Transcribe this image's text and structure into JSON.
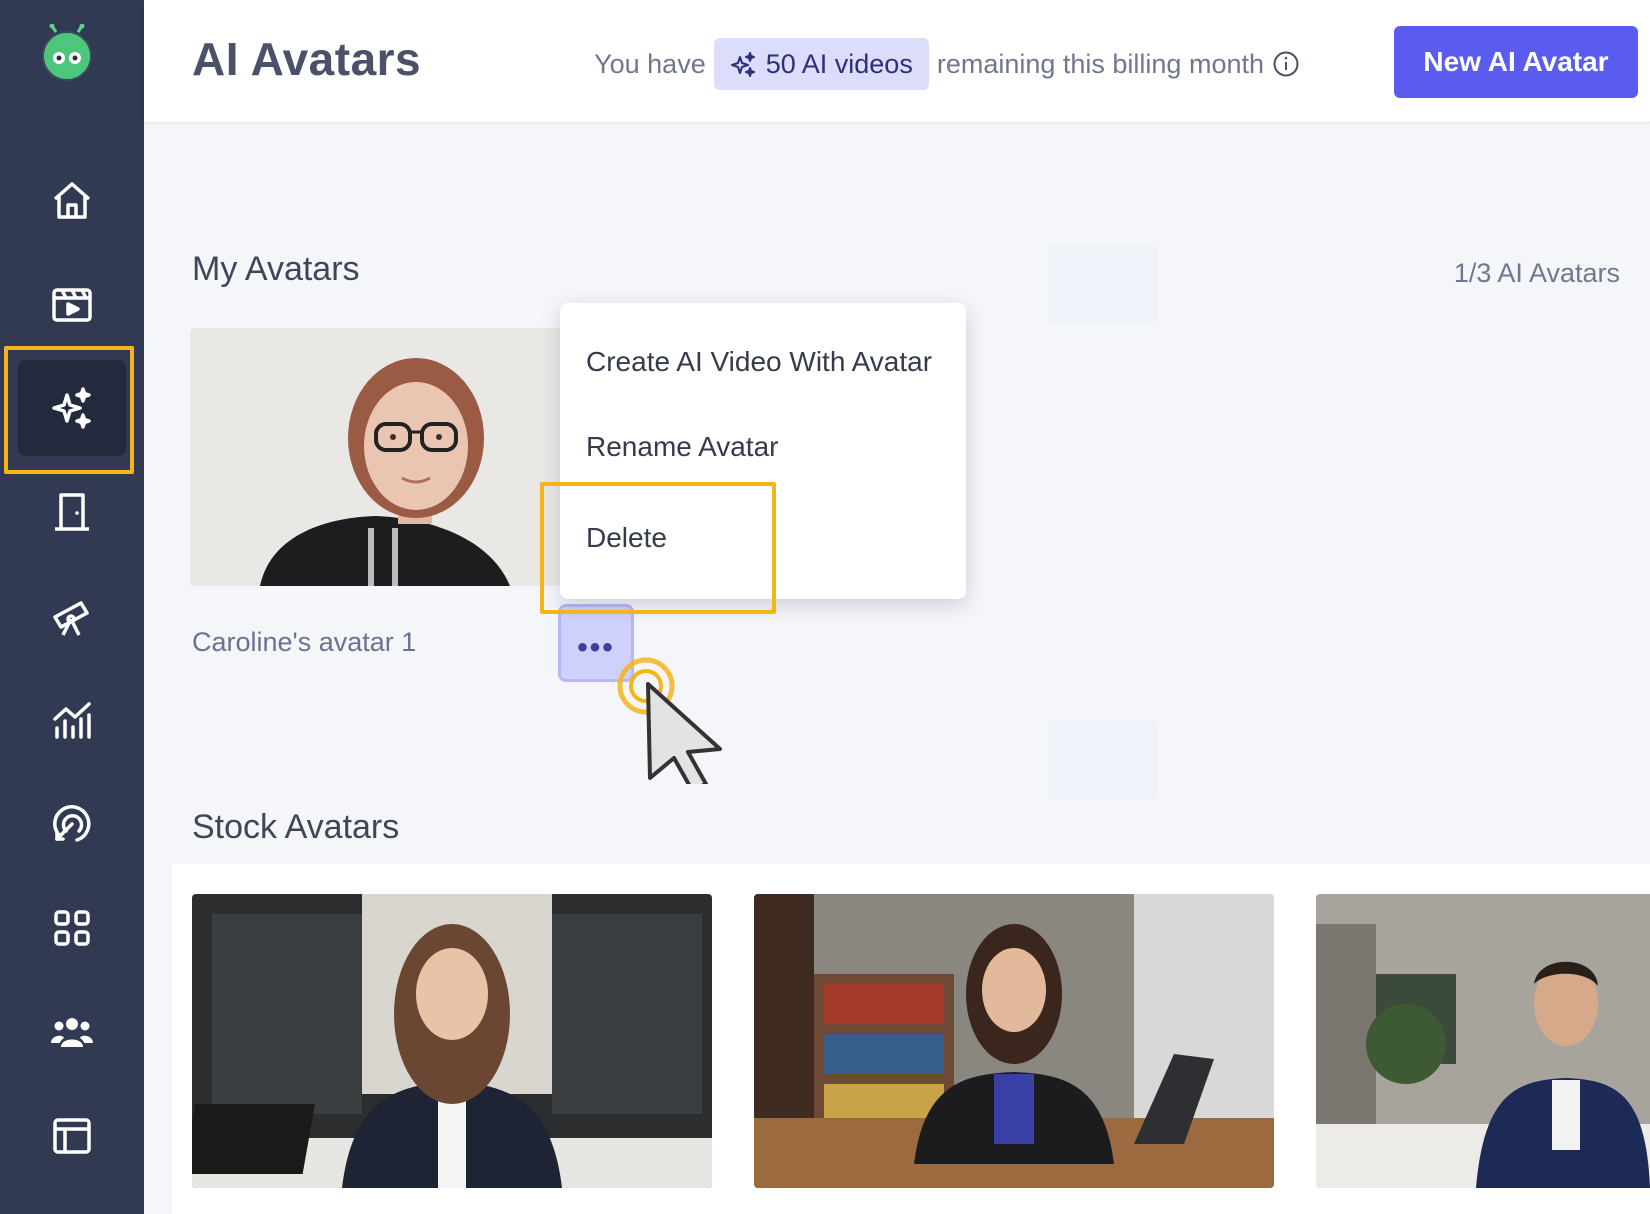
{
  "page": {
    "title": "AI Avatars",
    "new_button_label": "New AI Avatar"
  },
  "quota": {
    "prefix": "You have",
    "badge": "50 AI videos",
    "suffix": "remaining this billing month"
  },
  "sidebar": {
    "items": [
      {
        "icon": "home-icon"
      },
      {
        "icon": "video-clapper-icon"
      },
      {
        "icon": "sparkles-icon",
        "active": true
      },
      {
        "icon": "door-icon"
      },
      {
        "icon": "telescope-icon"
      },
      {
        "icon": "analytics-chart-icon"
      },
      {
        "icon": "target-icon"
      },
      {
        "icon": "apps-grid-icon"
      },
      {
        "icon": "team-icon"
      },
      {
        "icon": "layout-icon"
      }
    ]
  },
  "my_avatars": {
    "heading": "My Avatars",
    "counter": "1/3 AI Avatars",
    "items": [
      {
        "name": "Caroline's avatar 1"
      }
    ],
    "more_label": "•••"
  },
  "context_menu": {
    "items": [
      "Create AI Video With Avatar",
      "Rename Avatar",
      "Delete"
    ]
  },
  "stock_avatars": {
    "heading": "Stock Avatars"
  },
  "colors": {
    "sidebar": "#313a52",
    "accent": "#5a5cf0",
    "highlight": "#f4b51b",
    "badge_bg": "#dcdcfb"
  }
}
